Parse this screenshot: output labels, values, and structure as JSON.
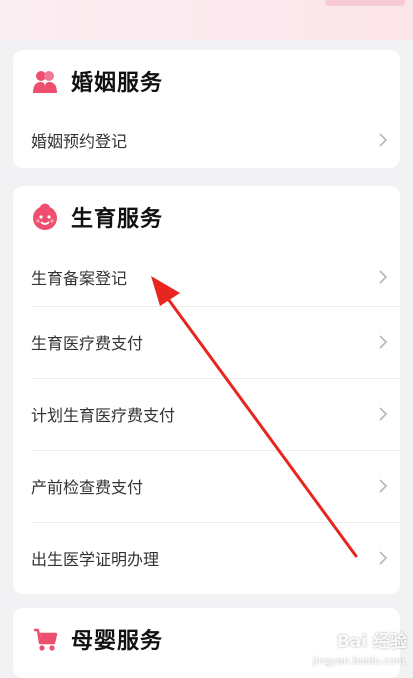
{
  "sections": [
    {
      "title": "婚姻服务",
      "icon": "couple-icon",
      "items": [
        {
          "label": "婚姻预约登记"
        }
      ]
    },
    {
      "title": "生育服务",
      "icon": "baby-face-icon",
      "items": [
        {
          "label": "生育备案登记"
        },
        {
          "label": "生育医疗费支付"
        },
        {
          "label": "计划生育医疗费支付"
        },
        {
          "label": "产前检查费支付"
        },
        {
          "label": "出生医学证明办理"
        }
      ]
    },
    {
      "title": "母婴服务",
      "icon": "stroller-icon",
      "items": []
    }
  ],
  "watermark": {
    "logo": "Bai 经验",
    "url": "jingyan.baidu.com"
  },
  "colors": {
    "accent": "#ef4f6e",
    "annotation_arrow": "#e8251f",
    "background": "#f2f2f4"
  }
}
